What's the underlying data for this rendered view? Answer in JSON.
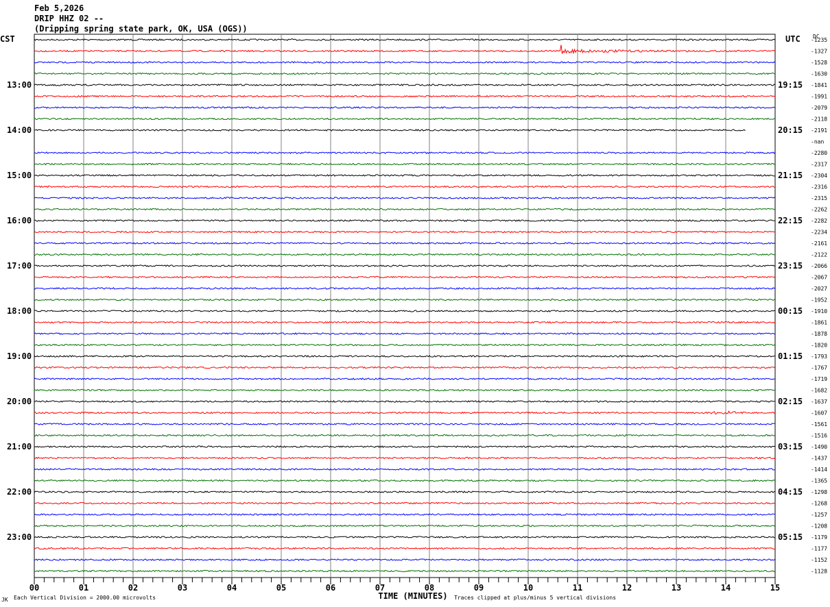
{
  "header": {
    "date": "Feb 5,2026",
    "station": "DRIP HHZ 02 --",
    "location": "(Dripping spring state park, OK, USA (OGS))"
  },
  "chart_data": {
    "type": "line",
    "title": "DRIP HHZ 02 -- helicorder",
    "left_timezone": "CST",
    "right_timezone": "UTC",
    "dc_header": "DC",
    "xlabel": "TIME (MINUTES)",
    "xticks": [
      "00",
      "01",
      "02",
      "03",
      "04",
      "05",
      "06",
      "07",
      "08",
      "09",
      "10",
      "11",
      "12",
      "13",
      "14",
      "15"
    ],
    "xlim": [
      0,
      15
    ],
    "footer_left": "Each Vertical Division = 2000.00 microvolts",
    "footer_right": "Traces clipped at plus/minus 5 vertical divisions",
    "corner_mark": "JK",
    "colors": [
      "#000000",
      "#ff0000",
      "#0000ff",
      "#007000"
    ],
    "left_hour_labels": [
      "13:00",
      "14:00",
      "15:00",
      "16:00",
      "17:00",
      "18:00",
      "19:00",
      "20:00",
      "21:00",
      "22:00",
      "23:00"
    ],
    "right_hour_labels": [
      "19:15",
      "20:15",
      "21:15",
      "22:15",
      "23:15",
      "00:15",
      "01:15",
      "02:15",
      "03:15",
      "04:15",
      "05:15"
    ],
    "dc_values": [
      "-1235",
      "-1327",
      "-1528",
      "-1630",
      "-1841",
      "-1991",
      "-2079",
      "-2118",
      "-2191",
      "-nan",
      "-2280",
      "-2317",
      "-2304",
      "-2316",
      "-2315",
      "-2262",
      "-2282",
      "-2234",
      "-2161",
      "-2122",
      "-2066",
      "-2067",
      "-2027",
      "-1952",
      "-1910",
      "-1861",
      "-1878",
      "-1820",
      "-1793",
      "-1767",
      "-1719",
      "-1682",
      "-1637",
      "-1607",
      "-1561",
      "-1516",
      "-1490",
      "-1437",
      "-1414",
      "-1365",
      "-1298",
      "-1268",
      "-1257",
      "-1208",
      "-1179",
      "-1177",
      "-1152",
      "-1128"
    ],
    "missing_traces": [
      9
    ],
    "partial_traces": [
      {
        "row": 8,
        "end_minute": 14.4
      }
    ],
    "events": [
      {
        "row": 1,
        "minute": 10.65,
        "amplitude": "large"
      },
      {
        "row": 33,
        "minute": 14.0,
        "amplitude": "medium"
      }
    ]
  }
}
